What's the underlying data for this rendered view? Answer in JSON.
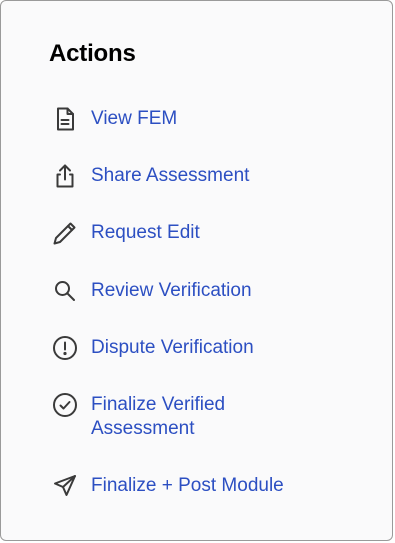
{
  "panel": {
    "title": "Actions"
  },
  "actions": [
    {
      "label": "View FEM",
      "icon": "document-icon"
    },
    {
      "label": "Share Assessment",
      "icon": "share-icon"
    },
    {
      "label": "Request Edit",
      "icon": "pencil-icon"
    },
    {
      "label": "Review Verification",
      "icon": "search-icon"
    },
    {
      "label": "Dispute Verification",
      "icon": "alert-circle-icon"
    },
    {
      "label": "Finalize Verified Assessment",
      "icon": "check-circle-icon"
    },
    {
      "label": "Finalize + Post Module",
      "icon": "send-icon"
    }
  ],
  "colors": {
    "link": "#2c4fc2",
    "icon": "#3a3a3a",
    "panel_background": "#fafafb",
    "border": "#9a9a9a"
  }
}
